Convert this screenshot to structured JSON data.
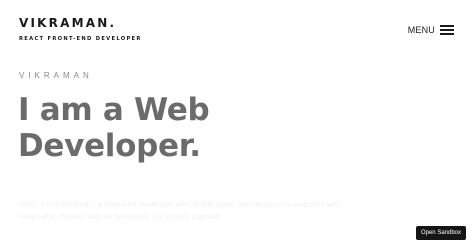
{
  "header": {
    "logo": "VIKRAMAN.",
    "tagline": "REACT FRONT-END DEVELOPER",
    "menu_label": "MENU",
    "menu_icon": "hamburger-icon"
  },
  "hero": {
    "eyebrow": "VIKRAMAN",
    "headline": "I am a Web Developer.",
    "description": "Hello, I am Vikraman, a front-end developer who builds clean and responsive websites with React and modern web technologies. Let's work together."
  },
  "sandbox": {
    "label": "Open Sandbox"
  },
  "colors": {
    "background": "#ffffff",
    "text_dark": "#1a1a1a",
    "headline": "#6b6b6b",
    "eyebrow": "#8a8a8a",
    "sandbox_bg": "#151515"
  }
}
